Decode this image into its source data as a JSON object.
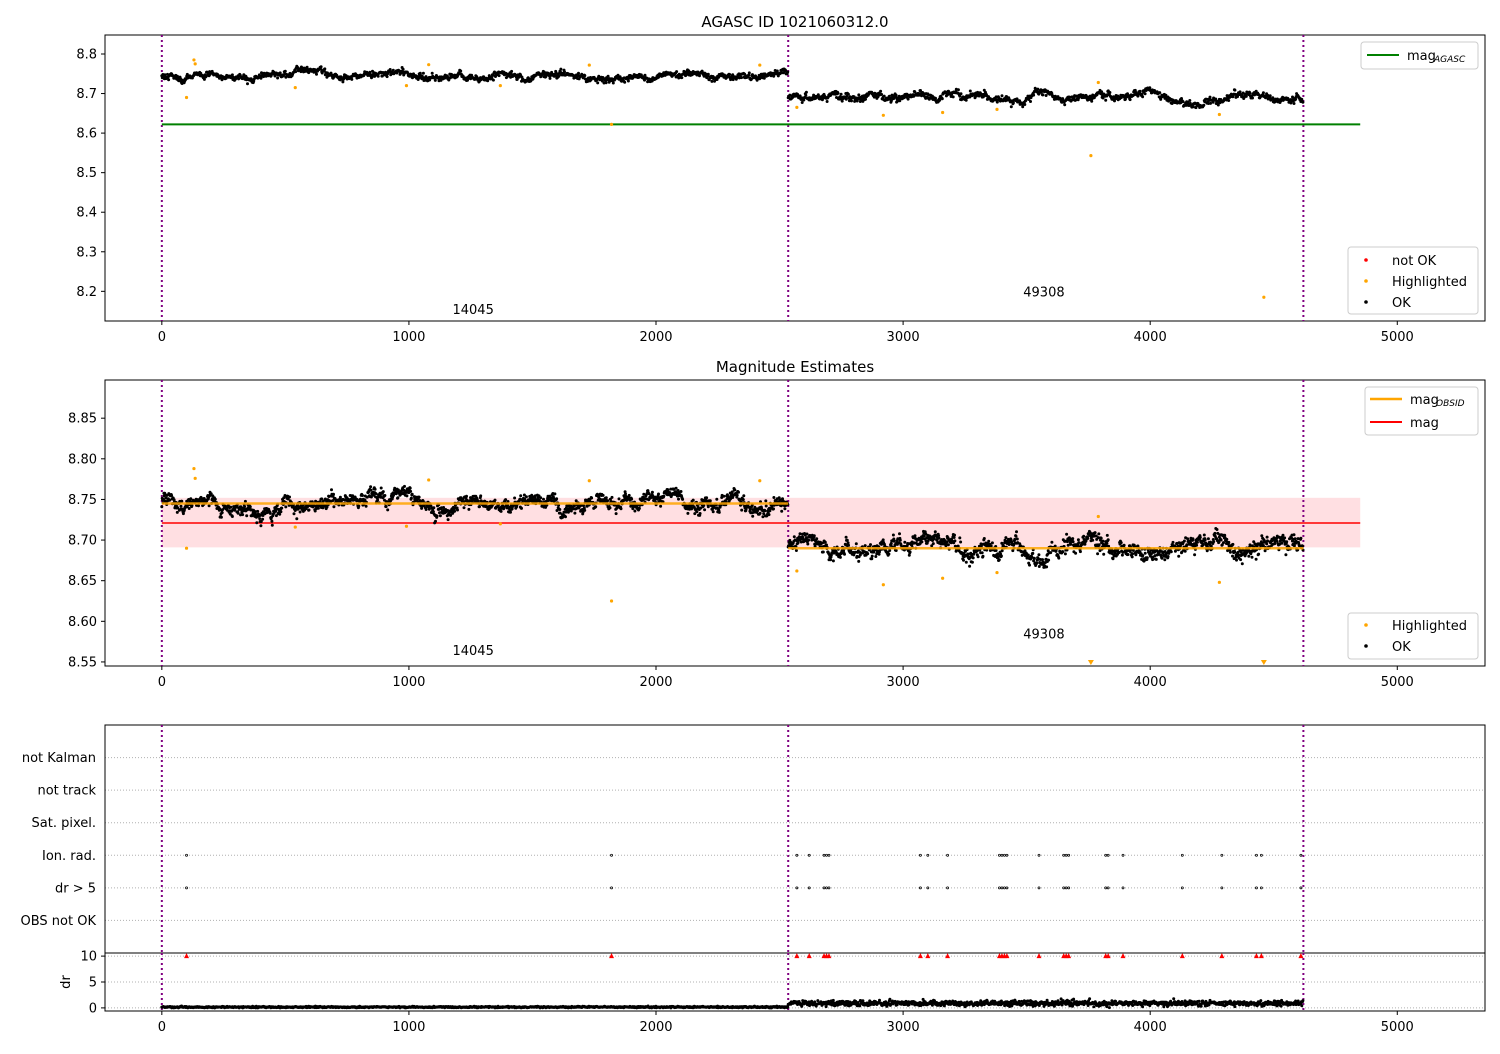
{
  "chart_data": [
    {
      "type": "scatter",
      "title": "AGASC ID 1021060312.0",
      "xlim": [
        -230,
        5355
      ],
      "ylim": [
        8.125,
        8.848
      ],
      "xticks": [
        0,
        1000,
        2000,
        3000,
        4000,
        5000
      ],
      "yticks": [
        8.2,
        8.3,
        8.4,
        8.5,
        8.6,
        8.7,
        8.8
      ],
      "obs_boundaries": [
        0,
        2535,
        4620
      ],
      "segments": [
        {
          "obsid": "14045",
          "x_range": [
            0,
            2535
          ],
          "mean": 8.745,
          "scatter": 0.007,
          "label_pos": [
            1260,
            8.155
          ]
        },
        {
          "obsid": "49308",
          "x_range": [
            2535,
            4620
          ],
          "mean": 8.69,
          "scatter": 0.008,
          "label_pos": [
            3570,
            8.2
          ]
        }
      ],
      "mag_agasc": 8.622,
      "mag_agasc_xrange": [
        0,
        4850
      ],
      "highlighted": [
        [
          130,
          8.785
        ],
        [
          135,
          8.775
        ],
        [
          100,
          8.69
        ],
        [
          540,
          8.715
        ],
        [
          990,
          8.72
        ],
        [
          1080,
          8.773
        ],
        [
          1370,
          8.72
        ],
        [
          1730,
          8.772
        ],
        [
          1820,
          8.622
        ],
        [
          2420,
          8.772
        ],
        [
          2570,
          8.665
        ],
        [
          2920,
          8.645
        ],
        [
          3160,
          8.652
        ],
        [
          3380,
          8.66
        ],
        [
          3760,
          8.543
        ],
        [
          3790,
          8.728
        ],
        [
          4280,
          8.647
        ],
        [
          4460,
          8.185
        ]
      ],
      "legend_top": {
        "line_label": "mag",
        "line_sub": "AGASC"
      },
      "legend_bottom": [
        "not OK",
        "Highlighted",
        "OK"
      ]
    },
    {
      "type": "scatter",
      "title": "Magnitude Estimates",
      "xlim": [
        -230,
        5355
      ],
      "ylim": [
        8.545,
        8.897
      ],
      "xticks": [
        0,
        1000,
        2000,
        3000,
        4000,
        5000
      ],
      "yticks": [
        8.55,
        8.6,
        8.65,
        8.7,
        8.75,
        8.8,
        8.85
      ],
      "obs_boundaries": [
        0,
        2535,
        4620
      ],
      "segments": [
        {
          "obsid": "14045",
          "x_range": [
            0,
            2535
          ],
          "mean": 8.745,
          "scatter": 0.007,
          "label_pos": [
            1260,
            8.565
          ]
        },
        {
          "obsid": "49308",
          "x_range": [
            2535,
            4620
          ],
          "mean": 8.69,
          "scatter": 0.008,
          "label_pos": [
            3570,
            8.585
          ]
        }
      ],
      "mag": 8.721,
      "mag_band": [
        8.691,
        8.752
      ],
      "mag_xrange": [
        0,
        4850
      ],
      "highlighted": [
        [
          130,
          8.788
        ],
        [
          135,
          8.776
        ],
        [
          100,
          8.69
        ],
        [
          540,
          8.716
        ],
        [
          990,
          8.717
        ],
        [
          1080,
          8.774
        ],
        [
          1370,
          8.72
        ],
        [
          1730,
          8.773
        ],
        [
          1820,
          8.625
        ],
        [
          2420,
          8.773
        ],
        [
          2570,
          8.662
        ],
        [
          2920,
          8.645
        ],
        [
          3160,
          8.653
        ],
        [
          3380,
          8.66
        ],
        [
          3790,
          8.729
        ],
        [
          4280,
          8.648
        ]
      ],
      "clipped_low": [
        3760,
        4460
      ],
      "legend_top": [
        {
          "label": "mag",
          "sub": "OBSID"
        },
        {
          "label": "mag"
        }
      ],
      "legend_bottom": [
        "Highlighted",
        "OK"
      ]
    },
    {
      "type": "scatter",
      "ylim": [
        -1,
        6
      ],
      "categories": [
        "OBS not OK",
        "dr > 5",
        "Ion. rad.",
        "Sat. pixel.",
        "not track",
        "not Kalman"
      ],
      "flagged_x": [
        100,
        1820,
        2570,
        2620,
        2680,
        2690,
        2700,
        3070,
        3100,
        3180,
        3390,
        3400,
        3410,
        3420,
        3550,
        3650,
        3660,
        3670,
        3820,
        3830,
        3890,
        4130,
        4290,
        4430,
        4450,
        4610
      ],
      "flag_rows": [
        "Ion. rad.",
        "dr > 5"
      ]
    },
    {
      "type": "scatter",
      "ylabel": "dr",
      "ylim": [
        -0.6,
        10.6
      ],
      "yticks": [
        0,
        5,
        10
      ],
      "xticks": [
        0,
        1000,
        2000,
        3000,
        4000,
        5000
      ],
      "segments": [
        {
          "x_range": [
            0,
            2535
          ],
          "mean": 0.15,
          "scatter": 0.12
        },
        {
          "x_range": [
            2535,
            4620
          ],
          "mean": 0.9,
          "scatter": 0.45
        }
      ],
      "clipped_high_value": 10
    }
  ],
  "colors": {
    "ok": "#000000",
    "highlighted": "#ffa500",
    "not_ok": "#ff0000",
    "agasc": "#008000",
    "mag": "#ff0000",
    "band": "#ffdfe2",
    "obsid": "#ffa500",
    "boundary": "#800080",
    "grid": "#b0b0b0"
  }
}
